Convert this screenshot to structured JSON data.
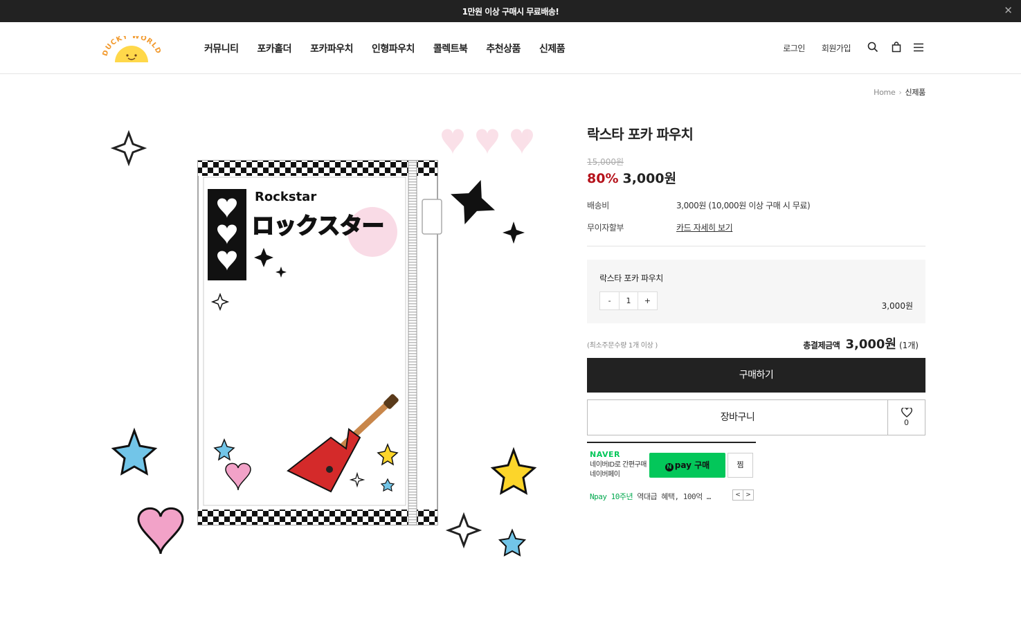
{
  "topbar": {
    "notice": "1만원 이상 구매시 무료배송!",
    "close_icon": "close-icon"
  },
  "header": {
    "logo_text": "DUCKY WORLD",
    "nav": [
      "커뮤니티",
      "포카홀더",
      "포카파우치",
      "인형파우치",
      "콜렉트북",
      "추천상품",
      "신제품"
    ],
    "login": "로그인",
    "join": "회원가입",
    "icons": [
      "search-icon",
      "bag-icon",
      "menu-icon"
    ]
  },
  "breadcrumb": {
    "home": "Home",
    "current": "신제품"
  },
  "product": {
    "image_text_en": "Rockstar",
    "image_text_jp": "ロックスター",
    "title": "락스타 포카 파우치",
    "original_price": "15,000원",
    "discount_rate": "80%",
    "sale_price": "3,000원",
    "shipping_label": "배송비",
    "shipping_value": "3,000원 (10,000원 이상 구매 시 무료)",
    "installment_label": "무이자할부",
    "installment_value": "카드 자세히 보기"
  },
  "option": {
    "name": "락스타 포카 파우치",
    "minus": "-",
    "qty": "1",
    "plus": "+",
    "price": "3,000원"
  },
  "summary": {
    "min_order": "(최소주문수량 1개 이상 )",
    "total_label": "총결제금액",
    "total_value": "3,000원",
    "total_count": "(1개)"
  },
  "buttons": {
    "buy": "구매하기",
    "cart": "장바구니",
    "wish_count": "0"
  },
  "npay": {
    "brand": "NAVER",
    "desc_line1": "네이버ID로 간편구매",
    "desc_line2": "네이버페이",
    "pay_label": "pay 구매",
    "n_mark": "N",
    "zzim": "찜",
    "promo_green": "Npay 10주년",
    "promo_rest": "역대급 혜택, 100억 …",
    "prev": "<",
    "next": ">"
  }
}
